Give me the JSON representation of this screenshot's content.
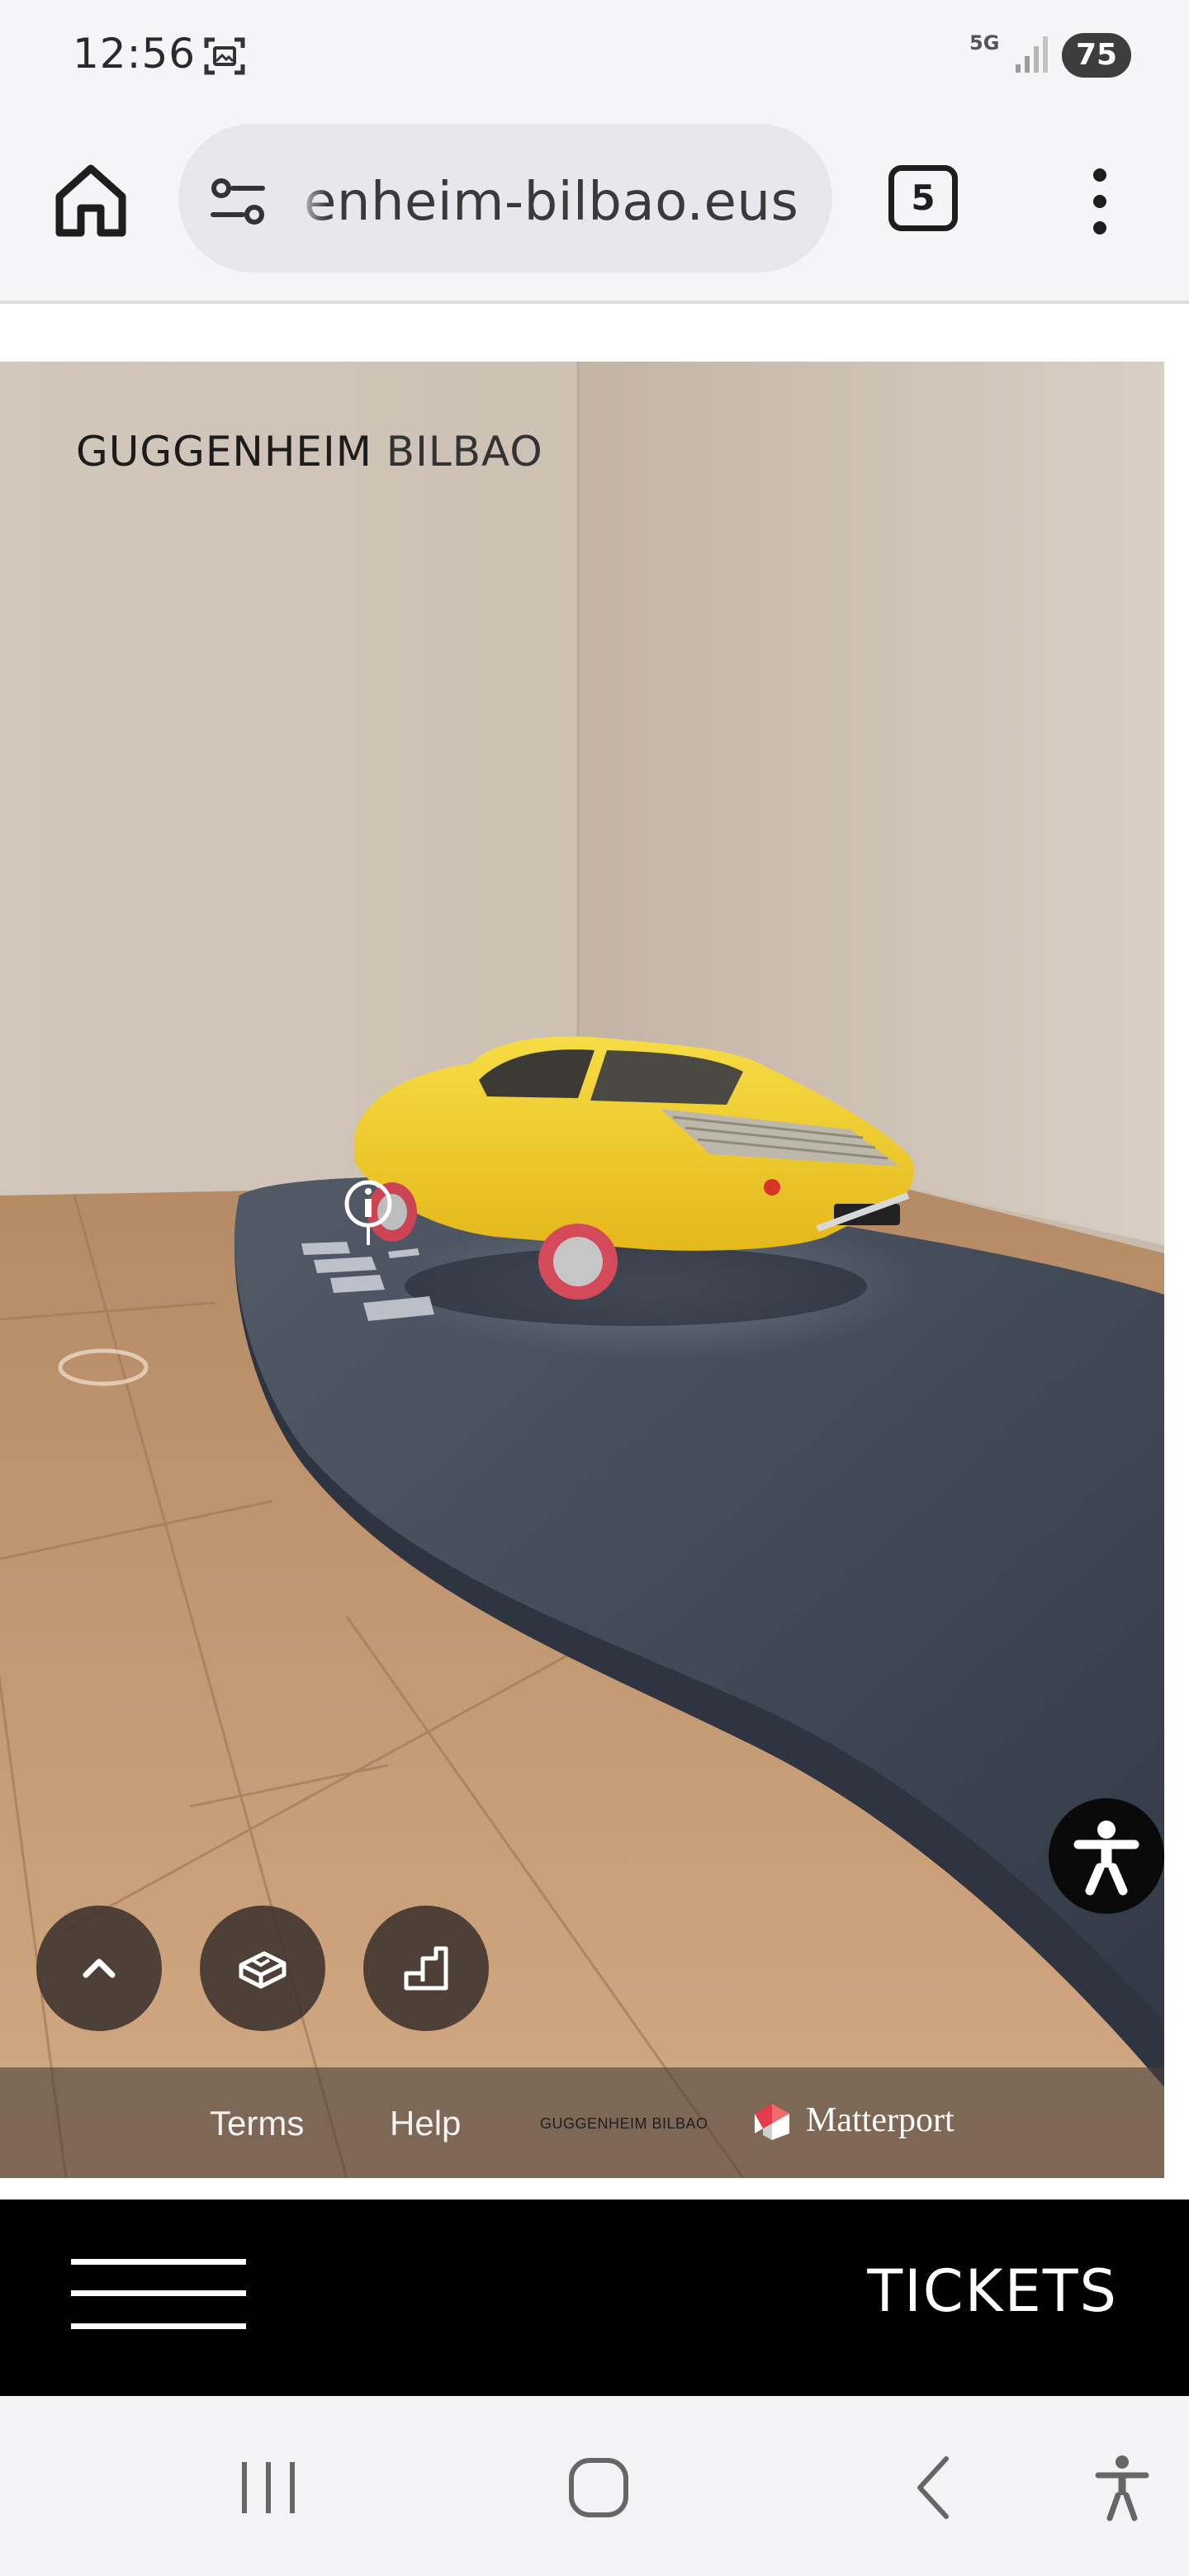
{
  "status_bar": {
    "time": "12:56",
    "network": "5G",
    "battery": "75"
  },
  "browser": {
    "url_text": "enheim-bilbao.eus",
    "tab_count": "5"
  },
  "viewer": {
    "brand_logo": {
      "bold": "GUGGENHEIM",
      "light": " BILBAO"
    },
    "footer": {
      "terms": "Terms",
      "help": "Help",
      "brand_small": "GUGGENHEIM BILBAO",
      "matterport": "Matterport"
    }
  },
  "site_nav": {
    "tickets": "TICKETS"
  },
  "icons": {
    "home": "home-icon",
    "site_settings": "tune-icon",
    "menu": "more-vert-icon",
    "accessibility": "accessibility-icon",
    "up": "chevron-up-icon",
    "dollhouse": "dollhouse-icon",
    "floorplan": "floorplan-icon",
    "matterport_logo": "matterport-logo-icon"
  },
  "colors": {
    "car": "#f2cd2a",
    "platform": "#3f4756",
    "floor": "#c59a72",
    "wall": "#cfc3b6"
  }
}
